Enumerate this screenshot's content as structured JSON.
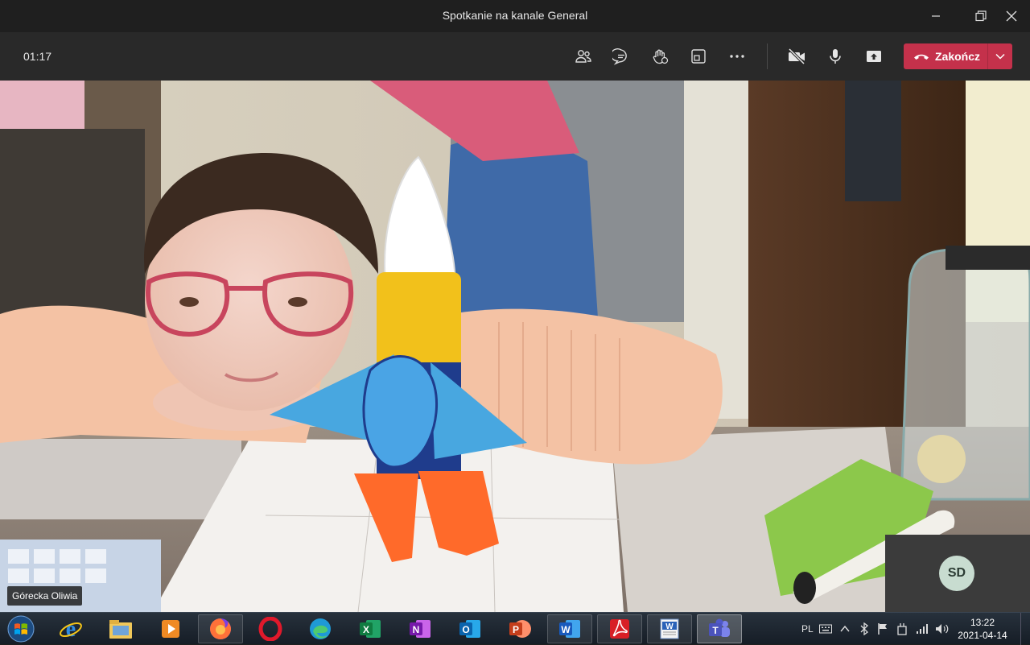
{
  "window": {
    "title": "Spotkanie na kanale General"
  },
  "toolbar": {
    "timer": "01:17",
    "leave_label": "Zakończ"
  },
  "video": {
    "participant_name": "Górecka Oliwia",
    "self_initials": "SD"
  },
  "taskbar": {
    "lang": "PL",
    "time": "13:22",
    "date": "2021-04-14",
    "apps": [
      "internet-explorer",
      "file-explorer",
      "media-player",
      "firefox",
      "opera",
      "edge",
      "excel",
      "onenote",
      "outlook",
      "powerpoint",
      "word",
      "acrobat-reader",
      "wordpad",
      "teams"
    ]
  },
  "colors": {
    "leave": "#c4314b",
    "toolbar": "#292929",
    "titlebar": "#1f1f1f"
  }
}
